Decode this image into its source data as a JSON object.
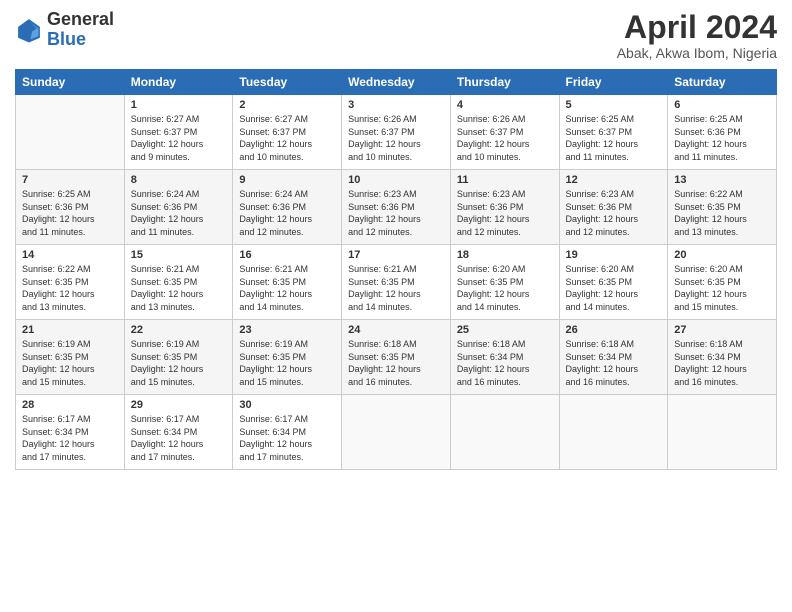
{
  "logo": {
    "general": "General",
    "blue": "Blue"
  },
  "title": "April 2024",
  "location": "Abak, Akwa Ibom, Nigeria",
  "days_header": [
    "Sunday",
    "Monday",
    "Tuesday",
    "Wednesday",
    "Thursday",
    "Friday",
    "Saturday"
  ],
  "weeks": [
    [
      {
        "day": "",
        "info": ""
      },
      {
        "day": "1",
        "info": "Sunrise: 6:27 AM\nSunset: 6:37 PM\nDaylight: 12 hours\nand 9 minutes."
      },
      {
        "day": "2",
        "info": "Sunrise: 6:27 AM\nSunset: 6:37 PM\nDaylight: 12 hours\nand 10 minutes."
      },
      {
        "day": "3",
        "info": "Sunrise: 6:26 AM\nSunset: 6:37 PM\nDaylight: 12 hours\nand 10 minutes."
      },
      {
        "day": "4",
        "info": "Sunrise: 6:26 AM\nSunset: 6:37 PM\nDaylight: 12 hours\nand 10 minutes."
      },
      {
        "day": "5",
        "info": "Sunrise: 6:25 AM\nSunset: 6:37 PM\nDaylight: 12 hours\nand 11 minutes."
      },
      {
        "day": "6",
        "info": "Sunrise: 6:25 AM\nSunset: 6:36 PM\nDaylight: 12 hours\nand 11 minutes."
      }
    ],
    [
      {
        "day": "7",
        "info": "Sunrise: 6:25 AM\nSunset: 6:36 PM\nDaylight: 12 hours\nand 11 minutes."
      },
      {
        "day": "8",
        "info": "Sunrise: 6:24 AM\nSunset: 6:36 PM\nDaylight: 12 hours\nand 11 minutes."
      },
      {
        "day": "9",
        "info": "Sunrise: 6:24 AM\nSunset: 6:36 PM\nDaylight: 12 hours\nand 12 minutes."
      },
      {
        "day": "10",
        "info": "Sunrise: 6:23 AM\nSunset: 6:36 PM\nDaylight: 12 hours\nand 12 minutes."
      },
      {
        "day": "11",
        "info": "Sunrise: 6:23 AM\nSunset: 6:36 PM\nDaylight: 12 hours\nand 12 minutes."
      },
      {
        "day": "12",
        "info": "Sunrise: 6:23 AM\nSunset: 6:36 PM\nDaylight: 12 hours\nand 12 minutes."
      },
      {
        "day": "13",
        "info": "Sunrise: 6:22 AM\nSunset: 6:35 PM\nDaylight: 12 hours\nand 13 minutes."
      }
    ],
    [
      {
        "day": "14",
        "info": "Sunrise: 6:22 AM\nSunset: 6:35 PM\nDaylight: 12 hours\nand 13 minutes."
      },
      {
        "day": "15",
        "info": "Sunrise: 6:21 AM\nSunset: 6:35 PM\nDaylight: 12 hours\nand 13 minutes."
      },
      {
        "day": "16",
        "info": "Sunrise: 6:21 AM\nSunset: 6:35 PM\nDaylight: 12 hours\nand 14 minutes."
      },
      {
        "day": "17",
        "info": "Sunrise: 6:21 AM\nSunset: 6:35 PM\nDaylight: 12 hours\nand 14 minutes."
      },
      {
        "day": "18",
        "info": "Sunrise: 6:20 AM\nSunset: 6:35 PM\nDaylight: 12 hours\nand 14 minutes."
      },
      {
        "day": "19",
        "info": "Sunrise: 6:20 AM\nSunset: 6:35 PM\nDaylight: 12 hours\nand 14 minutes."
      },
      {
        "day": "20",
        "info": "Sunrise: 6:20 AM\nSunset: 6:35 PM\nDaylight: 12 hours\nand 15 minutes."
      }
    ],
    [
      {
        "day": "21",
        "info": "Sunrise: 6:19 AM\nSunset: 6:35 PM\nDaylight: 12 hours\nand 15 minutes."
      },
      {
        "day": "22",
        "info": "Sunrise: 6:19 AM\nSunset: 6:35 PM\nDaylight: 12 hours\nand 15 minutes."
      },
      {
        "day": "23",
        "info": "Sunrise: 6:19 AM\nSunset: 6:35 PM\nDaylight: 12 hours\nand 15 minutes."
      },
      {
        "day": "24",
        "info": "Sunrise: 6:18 AM\nSunset: 6:35 PM\nDaylight: 12 hours\nand 16 minutes."
      },
      {
        "day": "25",
        "info": "Sunrise: 6:18 AM\nSunset: 6:34 PM\nDaylight: 12 hours\nand 16 minutes."
      },
      {
        "day": "26",
        "info": "Sunrise: 6:18 AM\nSunset: 6:34 PM\nDaylight: 12 hours\nand 16 minutes."
      },
      {
        "day": "27",
        "info": "Sunrise: 6:18 AM\nSunset: 6:34 PM\nDaylight: 12 hours\nand 16 minutes."
      }
    ],
    [
      {
        "day": "28",
        "info": "Sunrise: 6:17 AM\nSunset: 6:34 PM\nDaylight: 12 hours\nand 17 minutes."
      },
      {
        "day": "29",
        "info": "Sunrise: 6:17 AM\nSunset: 6:34 PM\nDaylight: 12 hours\nand 17 minutes."
      },
      {
        "day": "30",
        "info": "Sunrise: 6:17 AM\nSunset: 6:34 PM\nDaylight: 12 hours\nand 17 minutes."
      },
      {
        "day": "",
        "info": ""
      },
      {
        "day": "",
        "info": ""
      },
      {
        "day": "",
        "info": ""
      },
      {
        "day": "",
        "info": ""
      }
    ]
  ]
}
